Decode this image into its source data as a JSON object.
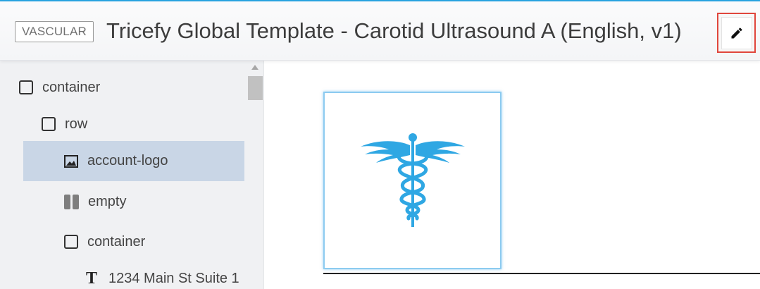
{
  "header": {
    "badge": "VASCULAR",
    "title": "Tricefy Global Template - Carotid Ultrasound A (English, v1)",
    "edit_icon": "pencil-icon",
    "edit_highlight_color": "#e0463c"
  },
  "sidebar": {
    "items": [
      {
        "label": "container",
        "icon": "square-icon"
      },
      {
        "label": "row",
        "icon": "square-icon"
      },
      {
        "label": "account-logo",
        "icon": "image-icon",
        "selected": true
      },
      {
        "label": "empty",
        "icon": "columns-icon"
      },
      {
        "label": "container",
        "icon": "square-icon"
      },
      {
        "label": "1234 Main St Suite 1",
        "icon": "text-icon"
      }
    ]
  },
  "canvas": {
    "logo": "caduceus-logo",
    "logo_color": "#2fa7e3"
  },
  "colors": {
    "selected_row": "#c9d6e6",
    "accent": "#29a3e0"
  }
}
